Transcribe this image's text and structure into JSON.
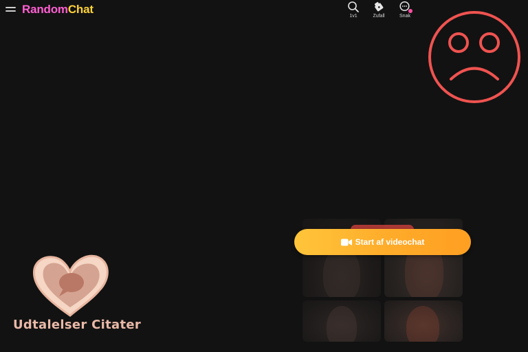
{
  "header": {
    "menu_icon": "hamburger-menu-icon",
    "logo": {
      "part1": "Random",
      "part2": "Chat",
      "color1": "#ff5fd2",
      "color2": "#ffd338"
    },
    "nav": [
      {
        "label": "1v1",
        "icon": "search-icon"
      },
      {
        "label": "Zufall",
        "icon": "tag-icon"
      },
      {
        "label": "Snak",
        "icon": "chat-bubble-icon",
        "badge": true
      }
    ]
  },
  "overlay": {
    "icon": "sad-face-icon",
    "color": "#ef5350"
  },
  "cta": {
    "label": "Start af videochat",
    "icon": "video-camera-icon",
    "color_start": "#ffc53a",
    "color_end": "#ff9f22"
  },
  "watermark": {
    "text": "Udtalelser Citater",
    "icon": "heart-speech-bubble-logo",
    "color": "#e9b9a8"
  }
}
